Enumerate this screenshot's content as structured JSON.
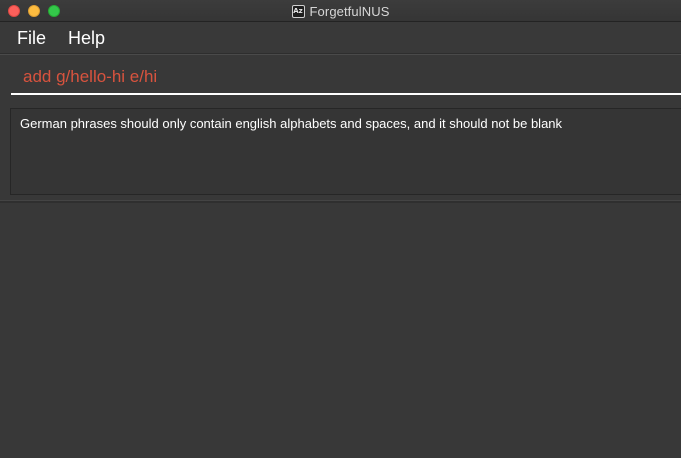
{
  "window": {
    "title": "ForgetfulNUS",
    "app_icon_glyph": "Az"
  },
  "menu": {
    "file_label": "File",
    "help_label": "Help"
  },
  "command_box": {
    "value": "add g/hello-hi e/hi",
    "text_color": "#d8533e"
  },
  "result_display": {
    "message": "German phrases should only contain english alphabets and spaces, and it should not be blank"
  },
  "colors": {
    "background": "#383838",
    "traffic_close": "#fc605b",
    "traffic_minimize": "#fdbc40",
    "traffic_maximize": "#34c84a"
  }
}
